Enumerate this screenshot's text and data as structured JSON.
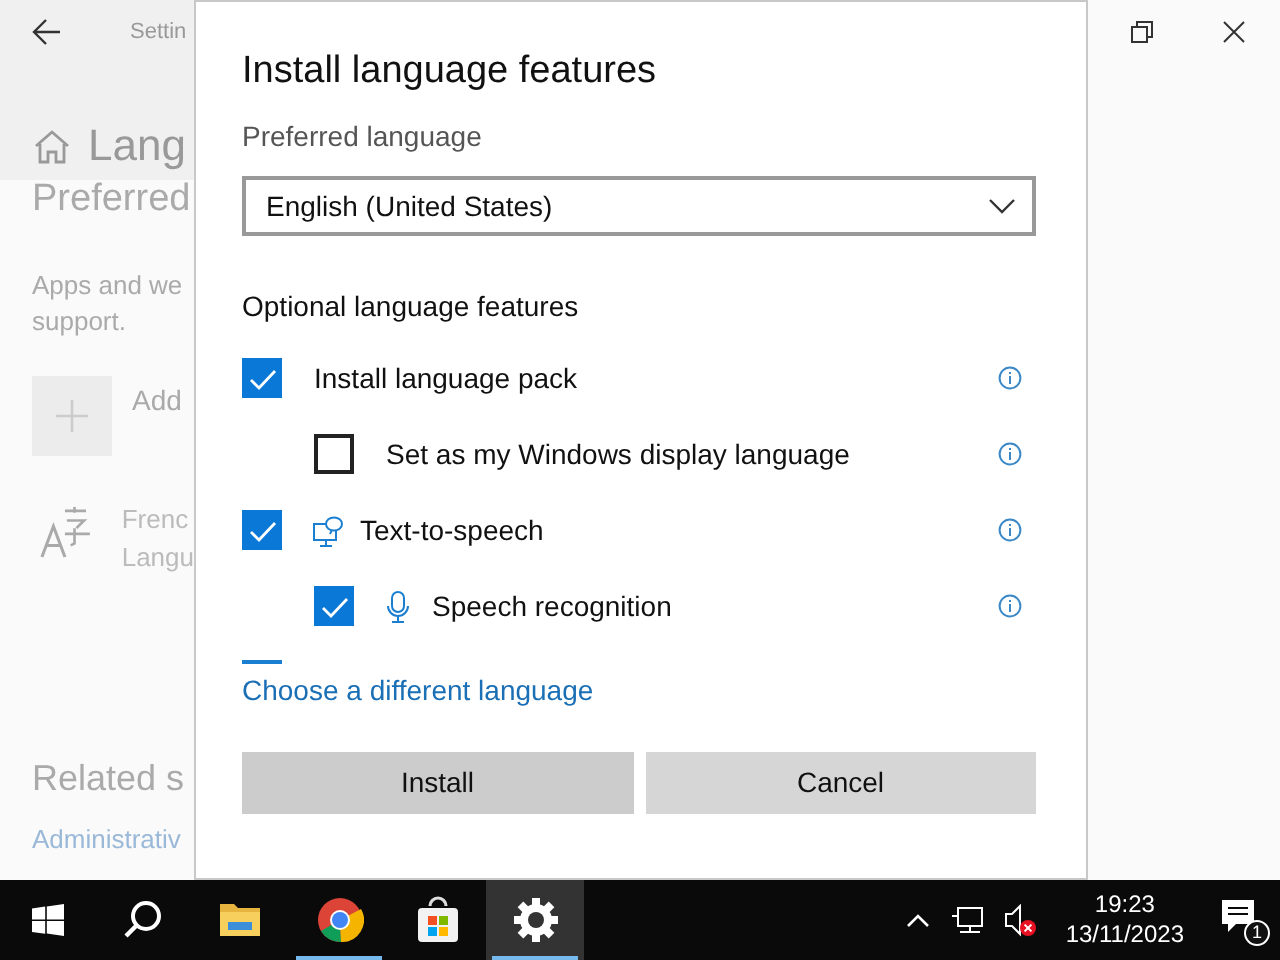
{
  "background_window": {
    "breadcrumb": "Settin",
    "page_title": "Lang",
    "section_title": "Preferred",
    "description": [
      "Apps and we",
      "support."
    ],
    "add_label": "Add",
    "language": {
      "name": "Frenc",
      "detail": "Langu"
    },
    "related_title": "Related s",
    "related_link": "Administrativ"
  },
  "dialog": {
    "title": "Install language features",
    "preferred_label": "Preferred language",
    "preferred_value": "English (United States)",
    "optional_title": "Optional language features",
    "features": [
      {
        "label": "Install language pack",
        "kind": "plain",
        "checked": true,
        "children": [
          {
            "label": "Set as my Windows display language",
            "kind": "plain",
            "checked": false
          }
        ]
      },
      {
        "label": "Text-to-speech",
        "kind": "speech",
        "checked": true,
        "children": [
          {
            "label": "Speech recognition",
            "kind": "microphone",
            "checked": true
          }
        ]
      }
    ],
    "link": "Choose a different language",
    "buttons": [
      {
        "label": "Install",
        "kind": "primary"
      },
      {
        "label": "Cancel",
        "kind": "secondary"
      }
    ]
  },
  "taskbar": {
    "apps": [
      {
        "kind": "folder",
        "running": false,
        "selected": false
      },
      {
        "kind": "chrome",
        "running": true,
        "selected": false
      },
      {
        "kind": "store",
        "running": false,
        "selected": false
      },
      {
        "kind": "settings",
        "running": true,
        "selected": true
      }
    ],
    "time": "19:23",
    "date": "13/11/2023",
    "notification_count": "1"
  }
}
